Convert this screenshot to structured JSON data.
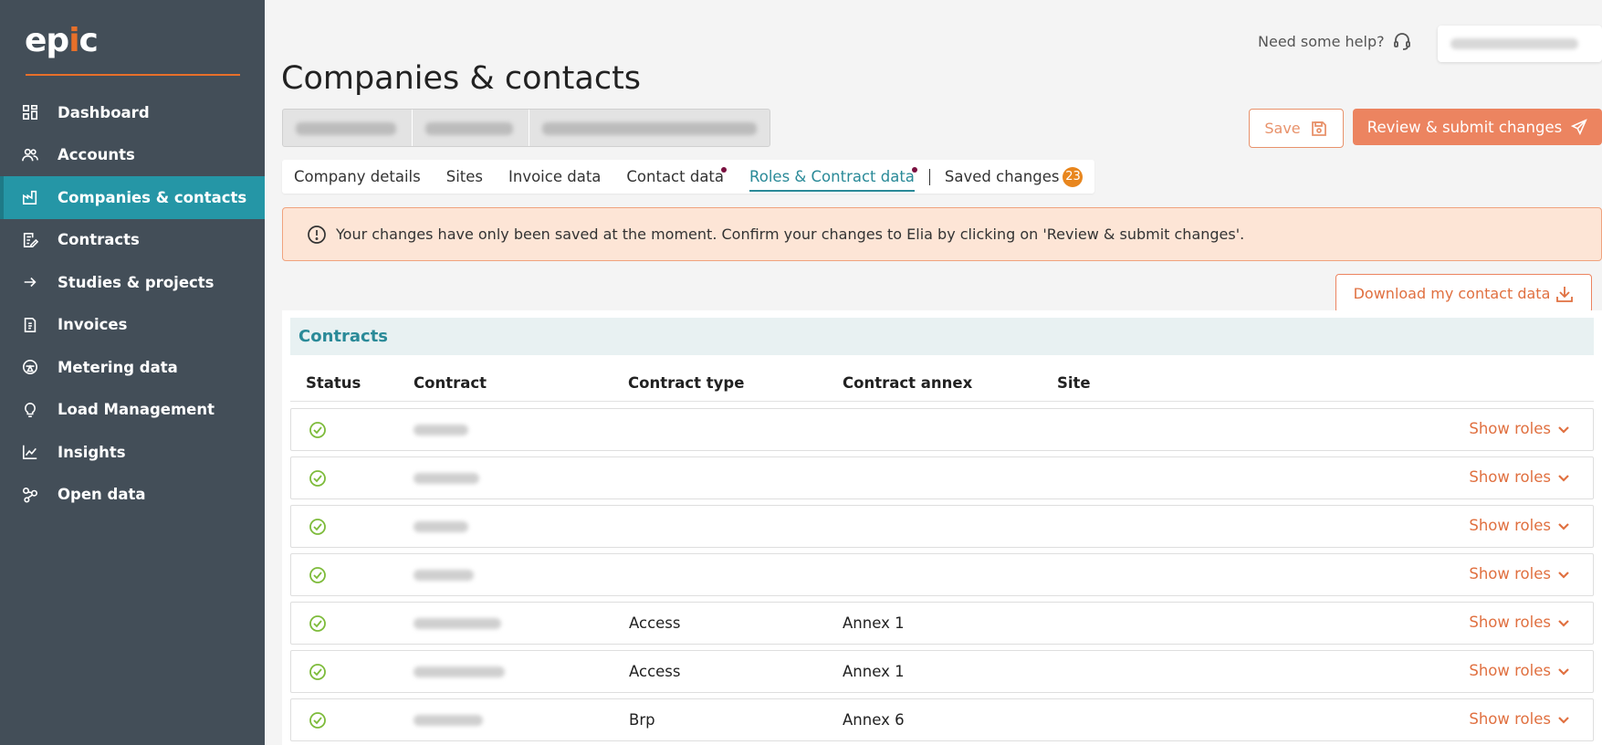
{
  "logo": {
    "text_e": "ep",
    "text_i": "i",
    "text_c": "c"
  },
  "sidebar": {
    "items": [
      {
        "label": "Dashboard",
        "icon": "dashboard-icon"
      },
      {
        "label": "Accounts",
        "icon": "accounts-icon"
      },
      {
        "label": "Companies & contacts",
        "icon": "factory-icon",
        "active": true
      },
      {
        "label": "Contracts",
        "icon": "contract-edit-icon"
      },
      {
        "label": "Studies & projects",
        "icon": "arrow-right-icon"
      },
      {
        "label": "Invoices",
        "icon": "invoice-icon"
      },
      {
        "label": "Metering data",
        "icon": "meter-icon"
      },
      {
        "label": "Load Management",
        "icon": "bulb-icon"
      },
      {
        "label": "Insights",
        "icon": "chart-line-icon"
      },
      {
        "label": "Open data",
        "icon": "open-data-icon"
      }
    ]
  },
  "header": {
    "help_text": "Need some help?",
    "title": "Companies & contacts"
  },
  "actions": {
    "save_label": "Save",
    "submit_label": "Review & submit changes",
    "download_label": "Download my contact data"
  },
  "tabs": [
    {
      "label": "Company details"
    },
    {
      "label": "Sites"
    },
    {
      "label": "Invoice data"
    },
    {
      "label": "Contact data",
      "dot": true
    },
    {
      "label": "Roles & Contract data",
      "dot": true,
      "active": true
    },
    {
      "label": "Saved changes",
      "badge": "23"
    }
  ],
  "warning": {
    "text": "Your changes have only been saved at the moment. Confirm your changes to Elia by clicking on 'Review & submit changes'."
  },
  "contracts": {
    "section_title": "Contracts",
    "columns": [
      "Status",
      "Contract",
      "Contract type",
      "Contract annex",
      "Site"
    ],
    "show_roles_label": "Show roles",
    "rows": [
      {
        "type": "",
        "annex": ""
      },
      {
        "type": "",
        "annex": ""
      },
      {
        "type": "",
        "annex": ""
      },
      {
        "type": "",
        "annex": ""
      },
      {
        "type": "Access",
        "annex": "Annex 1"
      },
      {
        "type": "Access",
        "annex": "Annex 1"
      },
      {
        "type": "Brp",
        "annex": "Annex 6"
      }
    ]
  },
  "colors": {
    "sidebar_bg": "#434e58",
    "accent_teal": "#2596a6",
    "accent_orange": "#ec8460",
    "status_green": "#7dbb3a",
    "warning_bg": "#fde5d6"
  }
}
